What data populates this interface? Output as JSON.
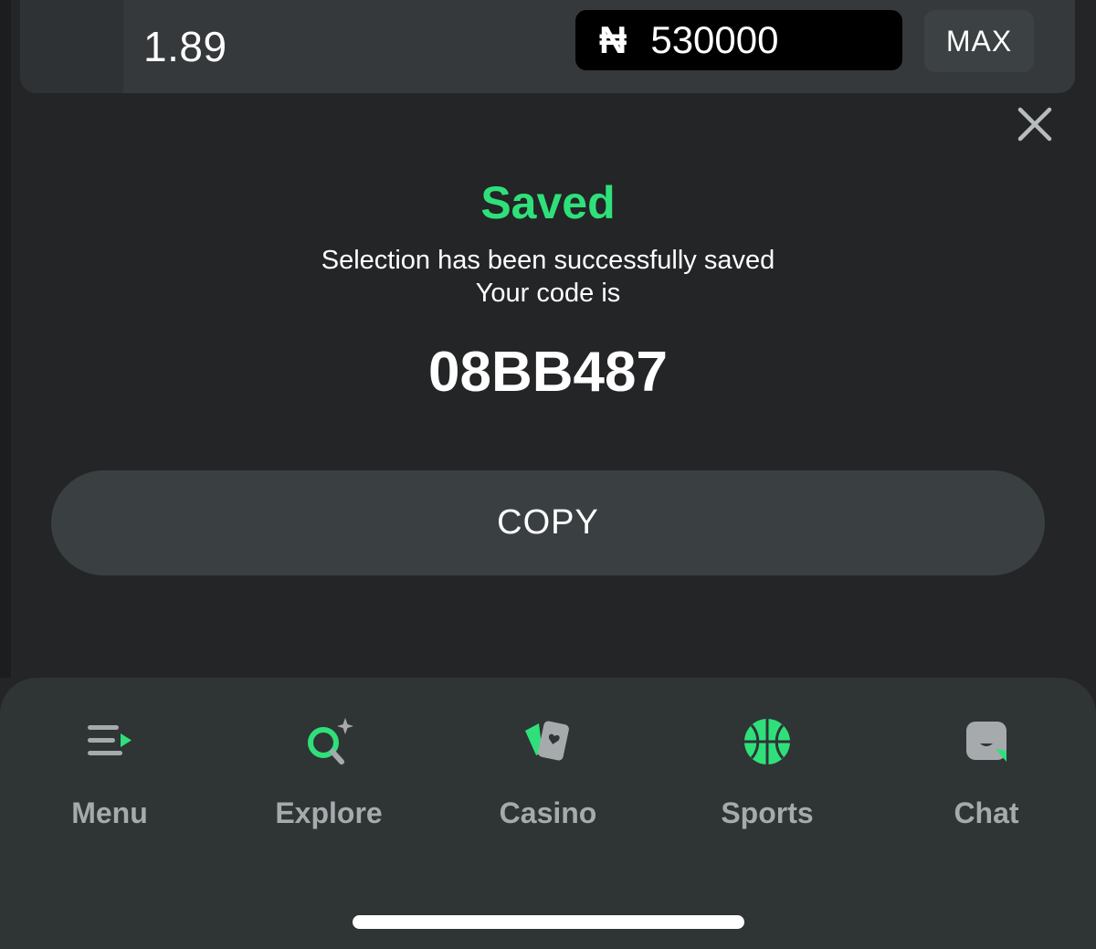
{
  "betslip": {
    "odds": "1.89",
    "stake_currency": "₦",
    "stake_value": "530000",
    "max_label": "MAX"
  },
  "modal": {
    "title": "Saved",
    "message_line1": "Selection has been successfully saved",
    "message_line2": "Your code is",
    "code": "08BB487",
    "copy_label": "COPY"
  },
  "nav": {
    "items": [
      {
        "label": "Menu",
        "icon": "menu-icon"
      },
      {
        "label": "Explore",
        "icon": "explore-search-icon"
      },
      {
        "label": "Casino",
        "icon": "casino-cards-icon"
      },
      {
        "label": "Sports",
        "icon": "basketball-icon"
      },
      {
        "label": "Chat",
        "icon": "chat-icon"
      }
    ]
  },
  "colors": {
    "accent": "#2fe07a",
    "background": "#232526",
    "nav_background": "#2f3435",
    "button": "#3a4042",
    "nav_label": "#a6aaad"
  }
}
